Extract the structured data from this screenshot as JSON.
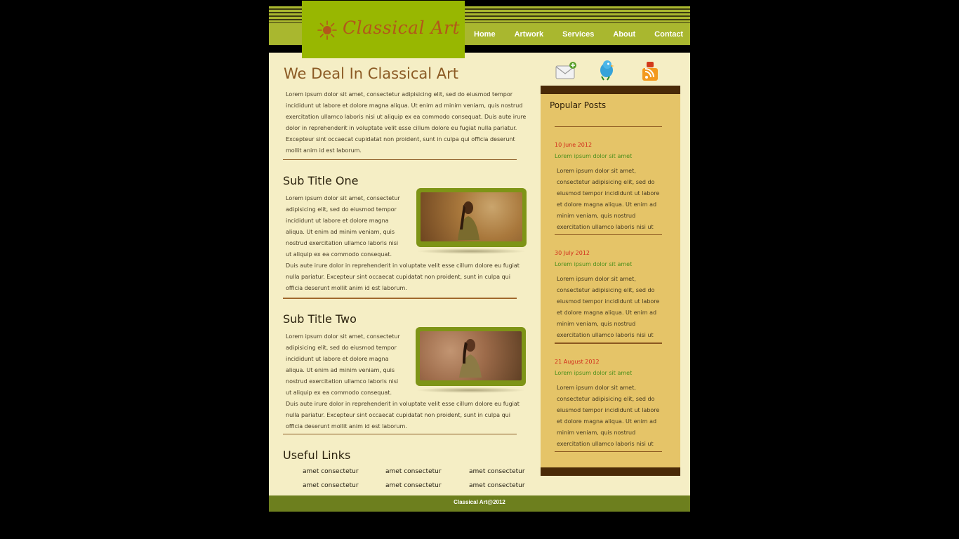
{
  "site": {
    "logo_text": "Classical Art",
    "logo_icon": "sun-icon"
  },
  "nav": {
    "items": [
      "Home",
      "Artwork",
      "Services",
      "About",
      "Contact"
    ]
  },
  "main": {
    "title": "We Deal In Classical Art",
    "intro": "Lorem ipsum dolor sit amet, consectetur adipisicing elit, sed do eiusmod tempor incididunt ut labore et dolore magna aliqua. Ut enim ad minim veniam, quis nostrud exercitation ullamco laboris nisi ut aliquip ex ea commodo consequat. Duis aute irure dolor in reprehenderit in voluptate velit esse cillum dolore eu fugiat nulla pariatur. Excepteur sint occaecat cupidatat non proident, sunt in culpa qui officia deserunt mollit anim id est laborum.",
    "sections": [
      {
        "title": "Sub Title One",
        "text": "Lorem ipsum dolor sit amet, consectetur adipisicing elit, sed do eiusmod tempor incididunt ut labore et dolore magna aliqua. Ut enim ad minim veniam, quis nostrud exercitation ullamco laboris nisi ut aliquip ex ea commodo consequat. Duis aute irure dolor in reprehenderit in voluptate velit esse cillum dolore eu fugiat nulla pariatur. Excepteur sint occaecat cupidatat non proident, sunt in culpa qui officia deserunt mollit anim id est laborum."
      },
      {
        "title": "Sub Title Two",
        "text": "Lorem ipsum dolor sit amet, consectetur adipisicing elit, sed do eiusmod tempor incididunt ut labore et dolore magna aliqua. Ut enim ad minim veniam, quis nostrud exercitation ullamco laboris nisi ut aliquip ex ea commodo consequat. Duis aute irure dolor in reprehenderit in voluptate velit esse cillum dolore eu fugiat nulla pariatur. Excepteur sint occaecat cupidatat non proident, sunt in culpa qui officia deserunt mollit anim id est laborum."
      }
    ],
    "useful_links": {
      "title": "Useful Links",
      "items": [
        "amet consectetur",
        "amet consectetur",
        "amet consectetur",
        "amet consectetur",
        "amet consectetur",
        "amet consectetur"
      ]
    }
  },
  "social": {
    "icons": [
      "mail-icon",
      "twitter-bird-icon",
      "rss-feed-icon"
    ]
  },
  "sidebar": {
    "title": "Popular Posts",
    "posts": [
      {
        "date": "10 June 2012",
        "title": "Lorem ipsum dolor sit amet",
        "text": "Lorem ipsum dolor sit amet, consectetur adipisicing elit, sed do eiusmod tempor incididunt ut labore et dolore magna aliqua. Ut enim ad minim veniam, quis nostrud exercitation ullamco laboris nisi ut"
      },
      {
        "date": "30 July 2012",
        "title": "Lorem ipsum dolor sit amet",
        "text": "Lorem ipsum dolor sit amet, consectetur adipisicing elit, sed do eiusmod tempor incididunt ut labore et dolore magna aliqua. Ut enim ad minim veniam, quis nostrud exercitation ullamco laboris nisi ut"
      },
      {
        "date": "21 August 2012",
        "title": "Lorem ipsum dolor sit amet",
        "text": "Lorem ipsum dolor sit amet, consectetur adipisicing elit, sed do eiusmod tempor incididunt ut labore et dolore magna aliqua. Ut enim ad minim veniam, quis nostrud exercitation ullamco laboris nisi ut"
      }
    ]
  },
  "footer": {
    "text": "Classical Art@2012"
  },
  "colors": {
    "header_green": "#a9b72f",
    "logo_green": "#98b701",
    "page_bg": "#f5eec5",
    "title_brown": "#8b5a24",
    "sidebar_bg": "#e5c468",
    "date_red": "#d12b1b",
    "post_title_green": "#4b8f1c",
    "footer_green": "#6d7f1e"
  }
}
